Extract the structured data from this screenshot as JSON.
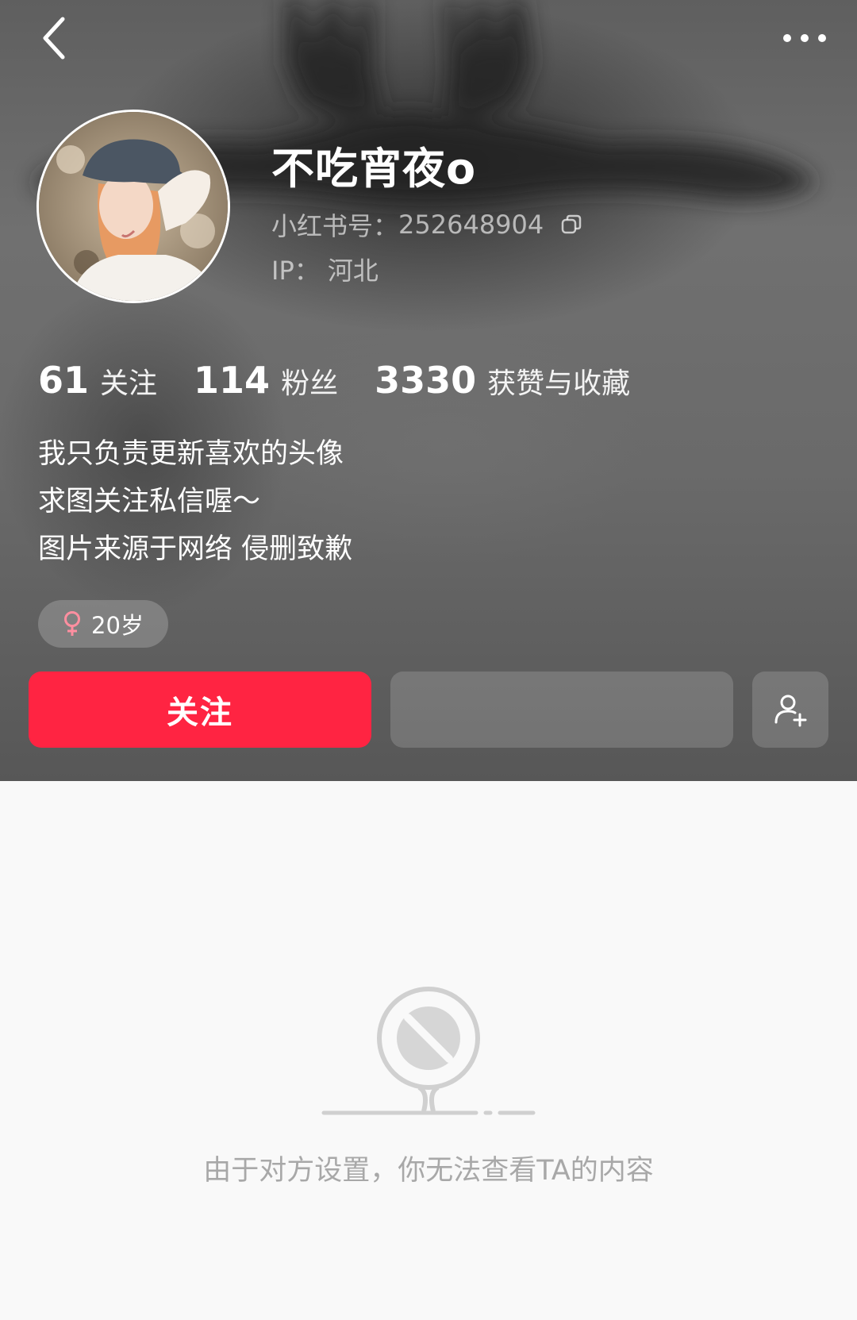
{
  "header": {
    "nickname": "不吃宵夜o",
    "id_label": "小红书号：",
    "id_value": "252648904",
    "ip_label": "IP：",
    "ip_value": "河北"
  },
  "stats": [
    {
      "value": "61",
      "label": "关注"
    },
    {
      "value": "114",
      "label": "粉丝"
    },
    {
      "value": "3330",
      "label": "获赞与收藏"
    }
  ],
  "bio": [
    "我只负责更新喜欢的头像",
    "求图关注私信喔～",
    "图片来源于网络 侵删致歉"
  ],
  "tag": {
    "gender_icon": "female-icon",
    "age": "20岁"
  },
  "actions": {
    "follow_label": "关注"
  },
  "empty_state": {
    "message": "由于对方设置，你无法查看TA的内容"
  },
  "colors": {
    "accent": "#ff2442",
    "female": "#ff8fa0",
    "empty_text": "#a8a8a8"
  }
}
